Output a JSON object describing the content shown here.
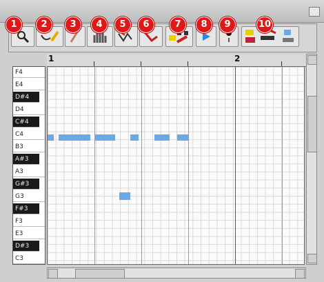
{
  "toolbar": {
    "tools": [
      {
        "num": "1",
        "icon": "magnifier-icon",
        "name": "zoom"
      },
      {
        "num": "2",
        "icon": "pencil-brush-icon",
        "name": "draw"
      },
      {
        "num": "3",
        "icon": "line-tool-icon",
        "name": "line"
      },
      {
        "num": "4",
        "icon": "hand-icon",
        "name": "hand"
      },
      {
        "num": "5",
        "icon": "arrow-curve-icon",
        "name": "arrow"
      },
      {
        "num": "6",
        "icon": "arrow-red-icon",
        "name": "red-arrow"
      },
      {
        "num": "7",
        "icon": "dice-icon",
        "name": "randomize"
      },
      {
        "num": "8",
        "icon": "play-icon",
        "name": "play"
      },
      {
        "num": "9",
        "icon": "record-icon",
        "name": "record"
      },
      {
        "num": "10",
        "icon": "pattern-icon",
        "name": "pattern"
      }
    ],
    "badge_color": "#e01818"
  },
  "ruler": {
    "marks": [
      "1",
      "2"
    ]
  },
  "keyboard": {
    "keys": [
      {
        "label": "F4",
        "color": "white"
      },
      {
        "label": "E4",
        "color": "white"
      },
      {
        "label": "D#4",
        "color": "black"
      },
      {
        "label": "D4",
        "color": "white"
      },
      {
        "label": "C#4",
        "color": "black"
      },
      {
        "label": "C4",
        "color": "white"
      },
      {
        "label": "B3",
        "color": "white"
      },
      {
        "label": "A#3",
        "color": "black"
      },
      {
        "label": "A3",
        "color": "white"
      },
      {
        "label": "G#3",
        "color": "black"
      },
      {
        "label": "G3",
        "color": "white"
      },
      {
        "label": "F#3",
        "color": "black"
      },
      {
        "label": "F3",
        "color": "white"
      },
      {
        "label": "E3",
        "color": "white"
      },
      {
        "label": "D#3",
        "color": "black"
      },
      {
        "label": "C3",
        "color": "white"
      }
    ]
  },
  "notes": {
    "color": "#6aa8e6"
  }
}
